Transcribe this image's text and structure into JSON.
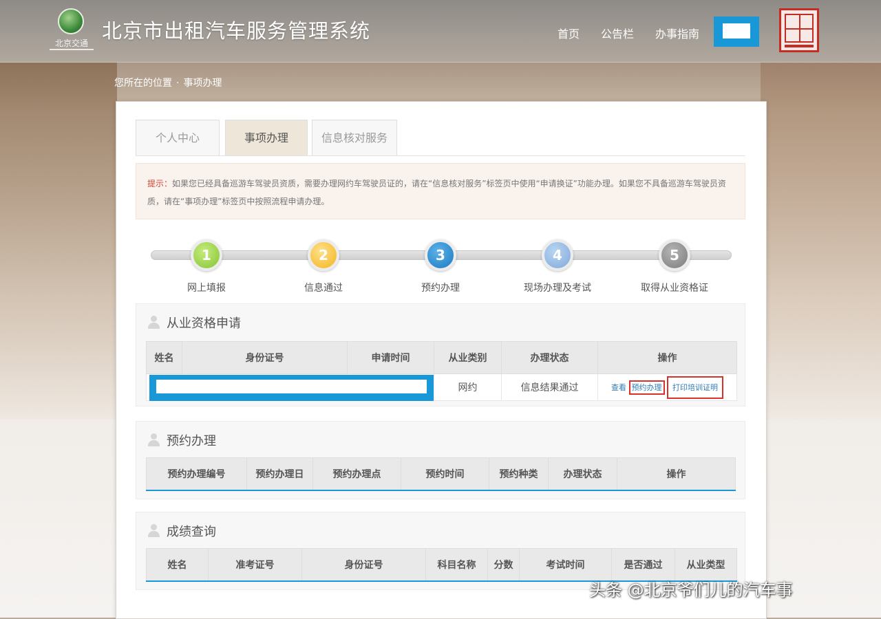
{
  "header": {
    "logo_text": "北京交通",
    "title": "北京市出租汽车服务管理系统",
    "nav": {
      "home": "首页",
      "notice": "公告栏",
      "guide": "办事指南"
    }
  },
  "breadcrumb": {
    "label": "您所在的位置",
    "current": "事项办理"
  },
  "tabs": [
    {
      "label": "个人中心",
      "active": false
    },
    {
      "label": "事项办理",
      "active": true
    },
    {
      "label": "信息核对服务",
      "active": false
    }
  ],
  "tip": {
    "label": "提示：",
    "text": "如果您已经具备巡游车驾驶员资质，需要办理网约车驾驶员证的，请在“信息核对服务”标签页中使用“申请换证”功能办理。如果您不具备巡游车驾驶员资质，请在“事项办理”标签页中按照流程申请办理。"
  },
  "steps": [
    {
      "num": "1",
      "label": "网上填报"
    },
    {
      "num": "2",
      "label": "信息通过"
    },
    {
      "num": "3",
      "label": "预约办理"
    },
    {
      "num": "4",
      "label": "现场办理及考试"
    },
    {
      "num": "5",
      "label": "取得从业资格证"
    }
  ],
  "qualification": {
    "title": "从业资格申请",
    "headers": [
      "姓名",
      "身份证号",
      "申请时间",
      "从业类别",
      "办理状态",
      "操作"
    ],
    "row": {
      "category": "网约",
      "status": "信息结果通过",
      "op_view": "查看",
      "op_reserve": "预约办理",
      "op_print": "打印培训证明"
    }
  },
  "appointment": {
    "title": "预约办理",
    "headers": [
      "预约办理编号",
      "预约办理日",
      "预约办理点",
      "预约时间",
      "预约种类",
      "办理状态",
      "操作"
    ]
  },
  "scores": {
    "title": "成绩查询",
    "headers": [
      "姓名",
      "准考证号",
      "身份证号",
      "科目名称",
      "分数",
      "考试时间",
      "是否通过",
      "从业类型"
    ]
  },
  "watermark": "头条 @北京爷们儿的汽车事",
  "colors": {
    "accent_blue": "#1898d6",
    "highlight_red": "#d7312a",
    "tip_red": "#d9453a"
  }
}
